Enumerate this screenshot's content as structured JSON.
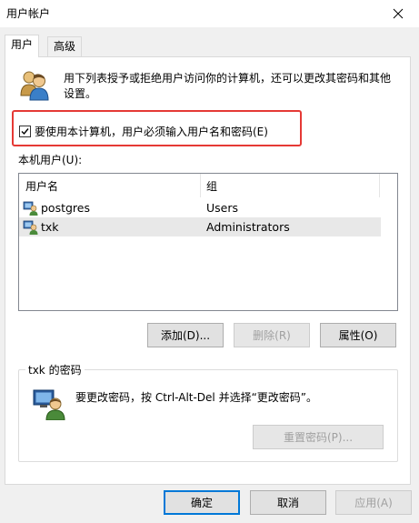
{
  "window": {
    "title": "用户帐户"
  },
  "tabs": [
    {
      "label": "用户",
      "active": true
    },
    {
      "label": "高级",
      "active": false
    }
  ],
  "intro": {
    "text_line1": "用下列表授予或拒绝用户访问你的计算机，还可以更改其密码和其他",
    "text_line2": "设置。",
    "icon": "users-icon"
  },
  "require_password": {
    "label": "要使用本计算机，用户必须输入用户名和密码(E)",
    "checked": true
  },
  "local_users": {
    "label": "本机用户(U):",
    "columns": [
      "用户名",
      "组"
    ],
    "rows": [
      {
        "name": "postgres",
        "group": "Users",
        "selected": false
      },
      {
        "name": "txk",
        "group": "Administrators",
        "selected": true
      }
    ]
  },
  "user_buttons": {
    "add": "添加(D)...",
    "remove": "删除(R)",
    "properties": "属性(O)"
  },
  "password_group": {
    "title": "txk 的密码",
    "text": "要更改密码，按 Ctrl-Alt-Del 并选择“更改密码”。",
    "reset_button": "重置密码(P)..."
  },
  "footer": {
    "ok": "确定",
    "cancel": "取消",
    "apply": "应用(A)"
  },
  "colors": {
    "highlight_red": "#e53935",
    "accent_blue": "#0078d7"
  }
}
